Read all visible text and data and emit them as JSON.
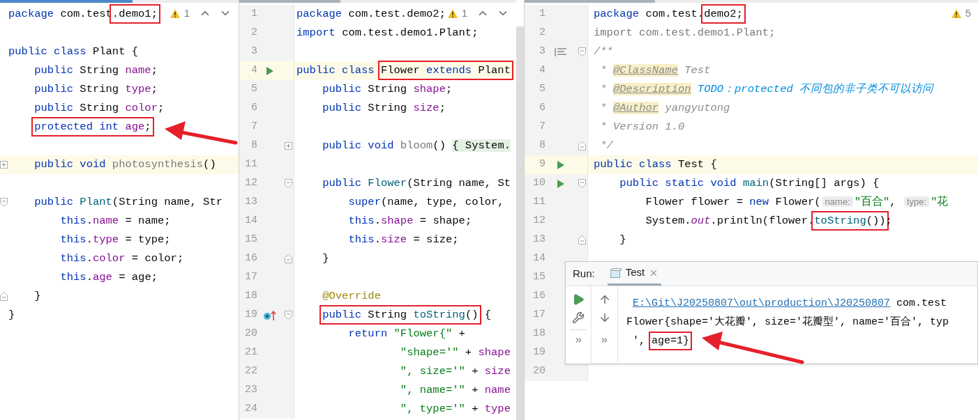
{
  "panes": [
    {
      "warnings": {
        "count": "1",
        "nav": true
      },
      "lines": [
        {
          "kind": "code",
          "tokens": [
            {
              "text": "package ",
              "kind": "kw"
            },
            {
              "text": "com.test",
              "kind": "p"
            },
            {
              "text": ".demo1;",
              "kind": "p",
              "boxed": true
            }
          ]
        },
        {
          "kind": "blank"
        },
        {
          "kind": "code",
          "tokens": [
            {
              "text": "public class ",
              "kind": "kw"
            },
            {
              "text": "Plant {",
              "kind": "p"
            }
          ]
        },
        {
          "kind": "code",
          "tokens": [
            {
              "text": "    public ",
              "kind": "kw"
            },
            {
              "text": "String ",
              "kind": "p"
            },
            {
              "text": "name",
              "kind": "field"
            },
            {
              "text": ";",
              "kind": "p"
            }
          ]
        },
        {
          "kind": "code",
          "tokens": [
            {
              "text": "    public ",
              "kind": "kw"
            },
            {
              "text": "String ",
              "kind": "p"
            },
            {
              "text": "type",
              "kind": "field"
            },
            {
              "text": ";",
              "kind": "p"
            }
          ]
        },
        {
          "kind": "code",
          "tokens": [
            {
              "text": "    public ",
              "kind": "kw"
            },
            {
              "text": "String ",
              "kind": "p"
            },
            {
              "text": "color",
              "kind": "field"
            },
            {
              "text": ";",
              "kind": "p"
            }
          ]
        },
        {
          "kind": "code",
          "tokens": [
            {
              "text": "    protected int ",
              "kind": "kw",
              "boxed": true
            },
            {
              "text": "age",
              "kind": "field",
              "boxed": true
            },
            {
              "text": ";",
              "kind": "p",
              "boxed": true
            }
          ]
        },
        {
          "kind": "blank"
        },
        {
          "kind": "code",
          "highlighted": true,
          "fold": {
            "kind": "plus"
          },
          "tokens": [
            {
              "text": "    public void ",
              "kind": "kw"
            },
            {
              "text": "photosynthesis",
              "kind": "unused"
            },
            {
              "text": "()",
              "kind": "p"
            }
          ]
        },
        {
          "kind": "blank"
        },
        {
          "kind": "code",
          "fold": {
            "kind": "open"
          },
          "tokens": [
            {
              "text": "    public ",
              "kind": "kw"
            },
            {
              "text": "Plant",
              "kind": "method"
            },
            {
              "text": "(String name, Str",
              "kind": "p"
            }
          ]
        },
        {
          "kind": "code",
          "tokens": [
            {
              "text": "        this",
              "kind": "kw"
            },
            {
              "text": ".",
              "kind": "p"
            },
            {
              "text": "name",
              "kind": "field"
            },
            {
              "text": " = name;",
              "kind": "p"
            }
          ]
        },
        {
          "kind": "code",
          "tokens": [
            {
              "text": "        this",
              "kind": "kw"
            },
            {
              "text": ".",
              "kind": "p"
            },
            {
              "text": "type",
              "kind": "field"
            },
            {
              "text": " = type;",
              "kind": "p"
            }
          ]
        },
        {
          "kind": "code",
          "tokens": [
            {
              "text": "        this",
              "kind": "kw"
            },
            {
              "text": ".",
              "kind": "p"
            },
            {
              "text": "color",
              "kind": "field"
            },
            {
              "text": " = color;",
              "kind": "p"
            }
          ]
        },
        {
          "kind": "code",
          "tokens": [
            {
              "text": "        this",
              "kind": "kw"
            },
            {
              "text": ".",
              "kind": "p"
            },
            {
              "text": "age",
              "kind": "field"
            },
            {
              "text": " = age;",
              "kind": "p"
            }
          ]
        },
        {
          "kind": "code",
          "fold": {
            "kind": "close"
          },
          "tokens": [
            {
              "text": "    }",
              "kind": "p"
            }
          ]
        },
        {
          "kind": "code",
          "tokens": [
            {
              "text": "}",
              "kind": "p"
            }
          ]
        }
      ]
    },
    {
      "warnings": {
        "count": "1",
        "nav": true
      },
      "lines": [
        {
          "kind": "code",
          "number": "1",
          "tokens": [
            {
              "text": "package ",
              "kind": "kw"
            },
            {
              "text": "com.test.demo2;",
              "kind": "p"
            }
          ]
        },
        {
          "kind": "code",
          "number": "2",
          "tokens": [
            {
              "text": "import ",
              "kind": "kw"
            },
            {
              "text": "com.test.demo1.Plant;",
              "kind": "p"
            }
          ]
        },
        {
          "kind": "blank",
          "number": "3"
        },
        {
          "kind": "code",
          "number": "4",
          "highlighted": true,
          "gutter_icon": {
            "kind": "run"
          },
          "tokens": [
            {
              "text": "public class ",
              "kind": "kw"
            },
            {
              "text": "Flower ",
              "kind": "p",
              "boxed": true
            },
            {
              "text": "extends ",
              "kind": "kw",
              "boxed": true
            },
            {
              "text": "Plant",
              "kind": "p",
              "boxed": true
            }
          ]
        },
        {
          "kind": "code",
          "number": "5",
          "tokens": [
            {
              "text": "    public ",
              "kind": "kw"
            },
            {
              "text": "String ",
              "kind": "p"
            },
            {
              "text": "shape",
              "kind": "field"
            },
            {
              "text": ";",
              "kind": "p"
            }
          ]
        },
        {
          "kind": "code",
          "number": "6",
          "tokens": [
            {
              "text": "    public ",
              "kind": "kw"
            },
            {
              "text": "String ",
              "kind": "p"
            },
            {
              "text": "size",
              "kind": "field"
            },
            {
              "text": ";",
              "kind": "p"
            }
          ]
        },
        {
          "kind": "blank",
          "number": "7"
        },
        {
          "kind": "code",
          "number": "8",
          "fold": {
            "kind": "plus"
          },
          "tokens": [
            {
              "text": "    public void ",
              "kind": "kw"
            },
            {
              "text": "bloom",
              "kind": "unused"
            },
            {
              "text": "() ",
              "kind": "p"
            },
            {
              "text": "{ System.",
              "kind": "folded"
            }
          ]
        },
        {
          "kind": "blank",
          "number": "11"
        },
        {
          "kind": "code",
          "number": "12",
          "fold": {
            "kind": "open"
          },
          "tokens": [
            {
              "text": "    public ",
              "kind": "kw"
            },
            {
              "text": "Flower",
              "kind": "method"
            },
            {
              "text": "(String name, St",
              "kind": "p"
            }
          ]
        },
        {
          "kind": "code",
          "number": "13",
          "tokens": [
            {
              "text": "        super",
              "kind": "kw"
            },
            {
              "text": "(name, type, color,",
              "kind": "p"
            }
          ]
        },
        {
          "kind": "code",
          "number": "14",
          "tokens": [
            {
              "text": "        this",
              "kind": "kw"
            },
            {
              "text": ".",
              "kind": "p"
            },
            {
              "text": "shape",
              "kind": "field"
            },
            {
              "text": " = shape;",
              "kind": "p"
            }
          ]
        },
        {
          "kind": "code",
          "number": "15",
          "tokens": [
            {
              "text": "        this",
              "kind": "kw"
            },
            {
              "text": ".",
              "kind": "p"
            },
            {
              "text": "size",
              "kind": "field"
            },
            {
              "text": " = size;",
              "kind": "p"
            }
          ]
        },
        {
          "kind": "code",
          "number": "16",
          "fold": {
            "kind": "close"
          },
          "tokens": [
            {
              "text": "    }",
              "kind": "p"
            }
          ]
        },
        {
          "kind": "blank",
          "number": "17"
        },
        {
          "kind": "code",
          "number": "18",
          "tokens": [
            {
              "text": "    @Override",
              "kind": "annotation"
            }
          ]
        },
        {
          "kind": "code",
          "number": "19",
          "gutter_icon": {
            "kind": "override"
          },
          "fold": {
            "kind": "open"
          },
          "tokens": [
            {
              "text": "    public ",
              "kind": "kw",
              "boxed": true
            },
            {
              "text": "String ",
              "kind": "p",
              "boxed": true
            },
            {
              "text": "toString",
              "kind": "method",
              "boxed": true
            },
            {
              "text": "()",
              "kind": "p",
              "boxed": true
            },
            {
              "text": " {",
              "kind": "p"
            }
          ]
        },
        {
          "kind": "code",
          "number": "20",
          "tokens": [
            {
              "text": "        return ",
              "kind": "kw"
            },
            {
              "text": "\"Flower{\"",
              "kind": "str"
            },
            {
              "text": " +",
              "kind": "p"
            }
          ]
        },
        {
          "kind": "code",
          "number": "21",
          "tokens": [
            {
              "text": "                \"shape='\"",
              "kind": "str"
            },
            {
              "text": " + ",
              "kind": "p"
            },
            {
              "text": "shape",
              "kind": "field"
            }
          ]
        },
        {
          "kind": "code",
          "number": "22",
          "tokens": [
            {
              "text": "                \", size='\"",
              "kind": "str"
            },
            {
              "text": " + ",
              "kind": "p"
            },
            {
              "text": "size",
              "kind": "field"
            }
          ]
        },
        {
          "kind": "code",
          "number": "23",
          "tokens": [
            {
              "text": "                \", name='\"",
              "kind": "str"
            },
            {
              "text": " + ",
              "kind": "p"
            },
            {
              "text": "name",
              "kind": "field"
            }
          ]
        },
        {
          "kind": "code",
          "number": "24",
          "tokens": [
            {
              "text": "                \", type='\"",
              "kind": "str"
            },
            {
              "text": " + ",
              "kind": "p"
            },
            {
              "text": "type",
              "kind": "field"
            }
          ]
        }
      ]
    },
    {
      "warnings": {
        "count": "5",
        "nav": false
      },
      "lines": [
        {
          "kind": "code",
          "number": "1",
          "tokens": [
            {
              "text": "package ",
              "kind": "kw"
            },
            {
              "text": "com.test.",
              "kind": "p"
            },
            {
              "text": "demo2;",
              "kind": "p",
              "boxed": true
            }
          ]
        },
        {
          "kind": "code",
          "number": "2",
          "tokens": [
            {
              "text": "import com.test.demo1.Plant;",
              "kind": "unused"
            }
          ]
        },
        {
          "kind": "code",
          "number": "3",
          "gutter_icon": {
            "kind": "doc"
          },
          "fold": {
            "kind": "open"
          },
          "tokens": [
            {
              "text": "/**",
              "kind": "comment"
            }
          ]
        },
        {
          "kind": "code",
          "number": "4",
          "tokens": [
            {
              "text": " * ",
              "kind": "comment"
            },
            {
              "text": "@ClassName",
              "kind": "doctag"
            },
            {
              "text": " Test",
              "kind": "comment"
            }
          ]
        },
        {
          "kind": "code",
          "number": "5",
          "tokens": [
            {
              "text": " * ",
              "kind": "comment"
            },
            {
              "text": "@Description",
              "kind": "doctag"
            },
            {
              "text": " TODO：protected 不同包的非子类不可以访问",
              "kind": "todo"
            }
          ]
        },
        {
          "kind": "code",
          "number": "6",
          "tokens": [
            {
              "text": " * ",
              "kind": "comment"
            },
            {
              "text": "@Author",
              "kind": "doctag"
            },
            {
              "text": " yangyutong",
              "kind": "comment"
            }
          ]
        },
        {
          "kind": "code",
          "number": "7",
          "tokens": [
            {
              "text": " * Version 1.0",
              "kind": "comment"
            }
          ]
        },
        {
          "kind": "code",
          "number": "8",
          "fold": {
            "kind": "close"
          },
          "tokens": [
            {
              "text": " */",
              "kind": "comment"
            }
          ]
        },
        {
          "kind": "code",
          "number": "9",
          "highlighted": true,
          "gutter_icon": {
            "kind": "run"
          },
          "tokens": [
            {
              "text": "public class ",
              "kind": "kw"
            },
            {
              "text": "Test {",
              "kind": "p"
            }
          ]
        },
        {
          "kind": "code",
          "number": "10",
          "gutter_icon": {
            "kind": "run"
          },
          "fold": {
            "kind": "open"
          },
          "tokens": [
            {
              "text": "    public static void ",
              "kind": "kw"
            },
            {
              "text": "main",
              "kind": "method"
            },
            {
              "text": "(String[] args) {",
              "kind": "p"
            }
          ]
        },
        {
          "kind": "code",
          "number": "11",
          "tokens": [
            {
              "text": "        Flower flower = ",
              "kind": "p"
            },
            {
              "text": "new ",
              "kind": "kw"
            },
            {
              "text": "Flower(",
              "kind": "p"
            },
            {
              "text": "name:",
              "kind": "hint"
            },
            {
              "text": "\"百合\"",
              "kind": "str"
            },
            {
              "text": ", ",
              "kind": "p"
            },
            {
              "text": "type:",
              "kind": "hint"
            },
            {
              "text": "\"花",
              "kind": "str"
            }
          ]
        },
        {
          "kind": "code",
          "number": "12",
          "tokens": [
            {
              "text": "        System.",
              "kind": "p"
            },
            {
              "text": "out",
              "kind": "static"
            },
            {
              "text": ".println(flower.",
              "kind": "p"
            },
            {
              "text": "toString",
              "kind": "method",
              "boxed": true
            },
            {
              "text": "())",
              "kind": "p",
              "boxed": true
            },
            {
              "text": ";",
              "kind": "p"
            }
          ]
        },
        {
          "kind": "code",
          "number": "13",
          "fold": {
            "kind": "close"
          },
          "tokens": [
            {
              "text": "    }",
              "kind": "p"
            }
          ]
        },
        {
          "kind": "blank",
          "number": "14"
        },
        {
          "kind": "blank",
          "number": "15"
        },
        {
          "kind": "blank",
          "number": "16"
        },
        {
          "kind": "blank",
          "number": "17"
        },
        {
          "kind": "blank",
          "number": "18"
        },
        {
          "kind": "blank",
          "number": "19"
        },
        {
          "kind": "blank",
          "number": "20"
        }
      ]
    }
  ],
  "run_panel": {
    "label": "Run:",
    "tabs": [
      {
        "label": "Test",
        "selected": true
      }
    ],
    "output": [
      {
        "tokens": [
          {
            "text": " E:\\Git\\J20250807\\out\\production\\J20250807",
            "kind": "link"
          },
          {
            "text": " com.test",
            "kind": "p"
          }
        ]
      },
      {
        "tokens": [
          {
            "text": "Flower{shape='大花瓣', size='花瓣型', name='百合', typ",
            "kind": "p"
          }
        ]
      },
      {
        "tokens": [
          {
            "text": " ', ",
            "kind": "p"
          },
          {
            "text": "age=1}",
            "kind": "p",
            "boxed": true
          }
        ]
      }
    ]
  }
}
